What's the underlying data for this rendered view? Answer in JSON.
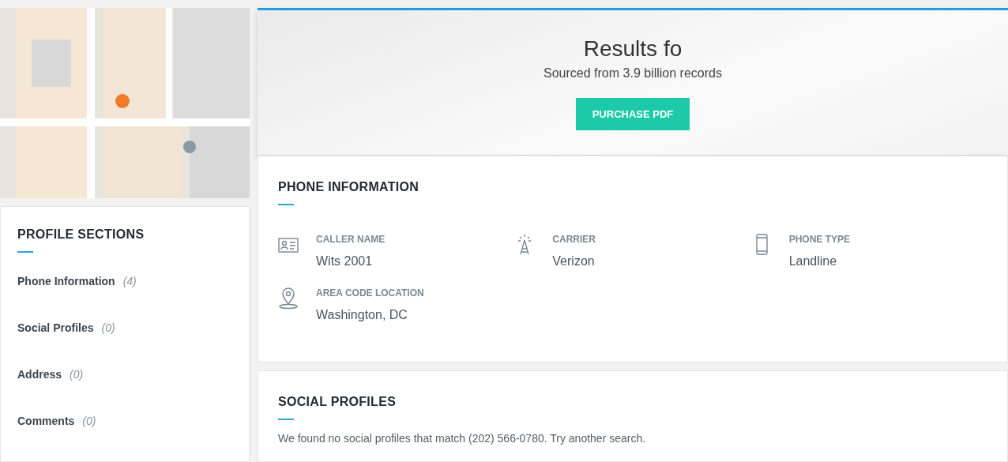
{
  "profile_sections": {
    "title": "PROFILE SECTIONS",
    "items": [
      {
        "label": "Phone Information",
        "count": "(4)"
      },
      {
        "label": "Social Profiles",
        "count": "(0)"
      },
      {
        "label": "Address",
        "count": "(0)"
      },
      {
        "label": "Comments",
        "count": "(0)"
      }
    ]
  },
  "header": {
    "title": "Results fo",
    "subtitle": "Sourced from 3.9 billion records",
    "button": "PURCHASE PDF"
  },
  "phone_information": {
    "title": "PHONE INFORMATION",
    "fields": [
      {
        "kind": "id-card",
        "label": "CALLER NAME",
        "value": "Wits 2001"
      },
      {
        "kind": "tower",
        "label": "CARRIER",
        "value": "Verizon"
      },
      {
        "kind": "phone",
        "label": "PHONE TYPE",
        "value": "Landline"
      },
      {
        "kind": "pin",
        "label": "AREA CODE LOCATION",
        "value": "Washington, DC"
      }
    ]
  },
  "social_profiles": {
    "title": "SOCIAL PROFILES",
    "message": "We found no social profiles that match (202) 566-0780. Try another search."
  }
}
